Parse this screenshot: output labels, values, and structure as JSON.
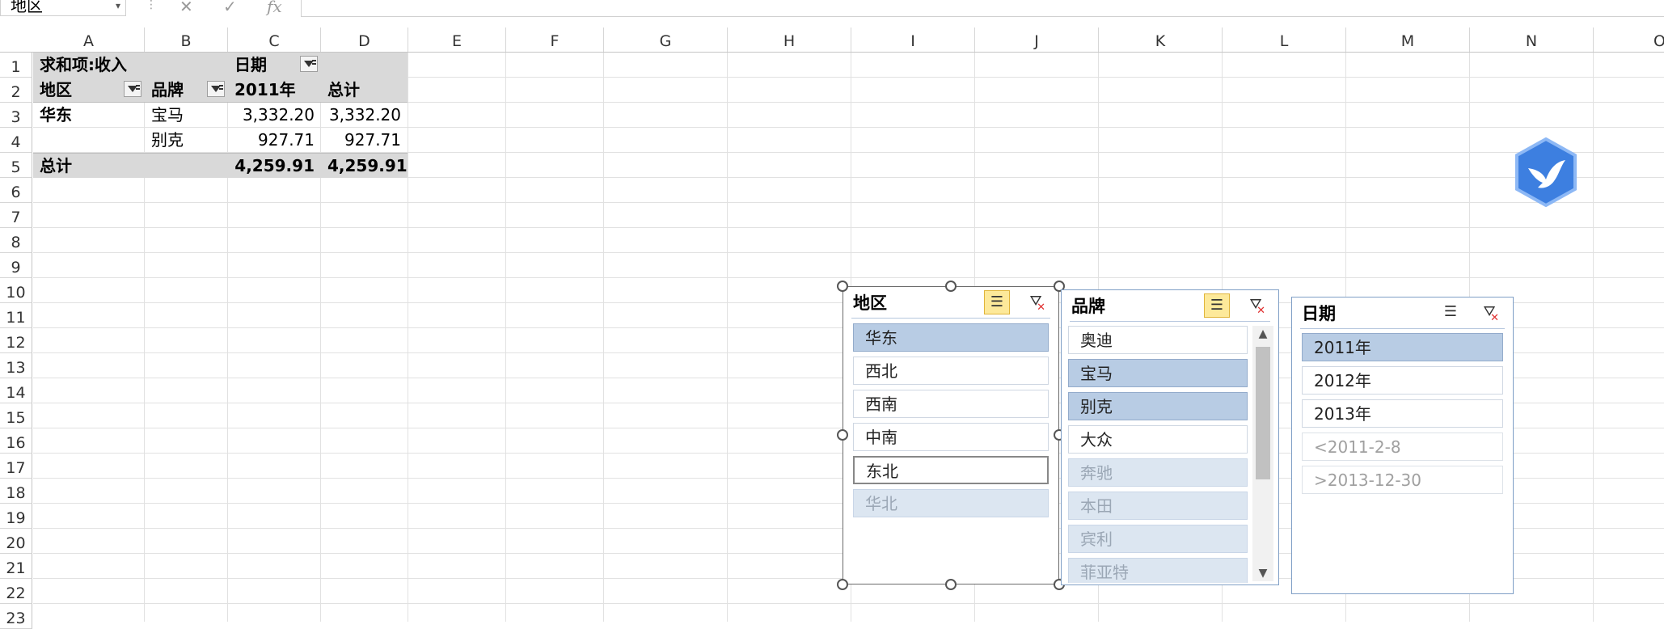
{
  "formula_bar": {
    "name_box": "地区",
    "fx": "fx",
    "cancel": "✕",
    "enter": "✓"
  },
  "columns": [
    "A",
    "B",
    "C",
    "D",
    "E",
    "F",
    "G",
    "H",
    "I",
    "J",
    "K",
    "L",
    "M",
    "N",
    "O"
  ],
  "rows": [
    "1",
    "2",
    "3",
    "4",
    "5",
    "6",
    "7",
    "8",
    "9",
    "10",
    "11",
    "12",
    "13",
    "14",
    "15",
    "16",
    "17",
    "18",
    "19",
    "20",
    "21",
    "22",
    "23"
  ],
  "pivot": {
    "title": "求和项:收入",
    "date_field": "日期",
    "region_field": "地区",
    "brand_field": "品牌",
    "year": "2011年",
    "total_header": "总计",
    "r3": {
      "region": "华东",
      "brand": "宝马",
      "value": "3,332.20",
      "total": "3,332.20"
    },
    "r4": {
      "brand": "别克",
      "value": "927.71",
      "total": "927.71"
    },
    "grand": {
      "label": "总计",
      "value": "4,259.91",
      "total": "4,259.91"
    }
  },
  "slicers": {
    "region": {
      "title": "地区",
      "items": [
        "华东",
        "西北",
        "西南",
        "中南",
        "东北",
        "华北"
      ]
    },
    "brand": {
      "title": "品牌",
      "items": [
        "奥迪",
        "宝马",
        "别克",
        "大众",
        "奔驰",
        "本田",
        "宾利",
        "菲亚特"
      ]
    },
    "date": {
      "title": "日期",
      "items": [
        "2011年",
        "2012年",
        "2013年",
        "<2011-2-8",
        ">2013-12-30"
      ]
    }
  },
  "colors": {
    "selected": "#b8cce4",
    "no_data": "#dce6f1",
    "header_gray": "#d9d9d9",
    "accent": "#fde99a"
  }
}
